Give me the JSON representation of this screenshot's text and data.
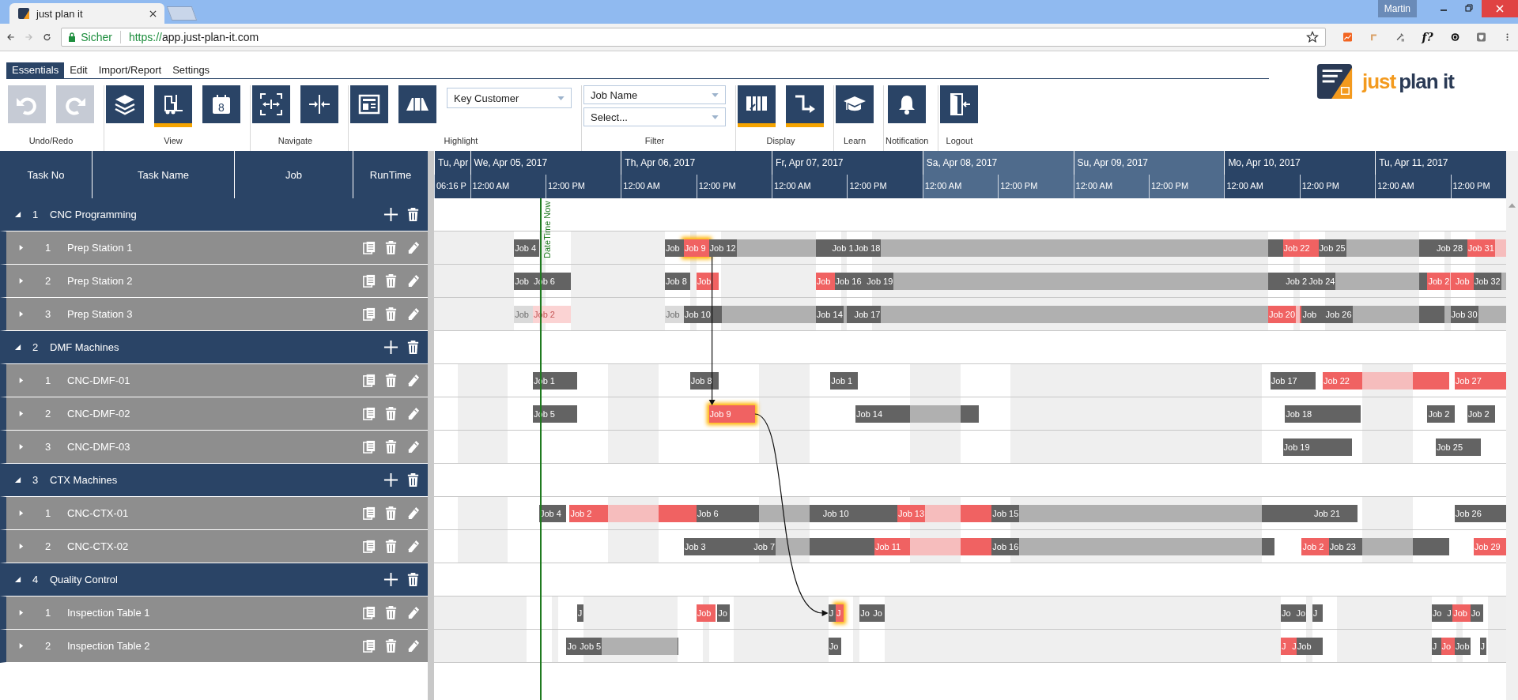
{
  "browser": {
    "tab_title": "just plan it",
    "user": "Martin",
    "security_label": "Sicher",
    "url_scheme": "https://",
    "url_host": "app.just-plan-it.com",
    "extension_text": "f?"
  },
  "ribbon": {
    "tabs": [
      {
        "label": "Essentials",
        "selected": true
      },
      {
        "label": "Edit",
        "selected": false
      },
      {
        "label": "Import/Report",
        "selected": false
      },
      {
        "label": "Settings",
        "selected": false
      }
    ],
    "groups": [
      {
        "label": "Undo/Redo",
        "items": [
          {
            "kind": "button",
            "active": false,
            "disabled": true
          },
          {
            "kind": "button",
            "active": false,
            "disabled": true
          }
        ]
      },
      {
        "label": "View",
        "items": [
          {
            "kind": "button",
            "active": false,
            "disabled": false
          },
          {
            "kind": "button",
            "active": true,
            "disabled": false
          },
          {
            "kind": "button",
            "icon_text": "8",
            "active": false,
            "disabled": false
          }
        ]
      },
      {
        "label": "Navigate",
        "items": [
          {
            "kind": "button",
            "active": false,
            "disabled": false
          },
          {
            "kind": "button",
            "active": false,
            "disabled": false
          }
        ]
      },
      {
        "label": "Highlight",
        "items": [
          {
            "kind": "button",
            "active": false,
            "disabled": false
          },
          {
            "kind": "button",
            "active": false,
            "disabled": false
          },
          {
            "kind": "dropdown",
            "value": "Key Customer"
          }
        ]
      },
      {
        "label": "Filter",
        "items": [
          {
            "kind": "dropdown_stack",
            "fields": [
              {
                "value": "Job Name"
              },
              {
                "value": "Select..."
              }
            ]
          }
        ]
      },
      {
        "label": "Display",
        "items": [
          {
            "kind": "button",
            "active": true,
            "disabled": false
          },
          {
            "kind": "button",
            "active": true,
            "disabled": false
          }
        ]
      },
      {
        "label": "Learn",
        "items": [
          {
            "kind": "button",
            "active": false,
            "disabled": false
          }
        ]
      },
      {
        "label": "Notification",
        "items": [
          {
            "kind": "button",
            "active": false,
            "disabled": false
          }
        ]
      },
      {
        "label": "Logout",
        "items": [
          {
            "kind": "button",
            "active": false,
            "disabled": false
          }
        ]
      }
    ]
  },
  "logo": {
    "word_1": "just",
    "word_2": "plan it"
  },
  "timeline": {
    "days": [
      {
        "label": "Tu, Apr",
        "weekend": false,
        "ticks": [
          "06:16 P"
        ]
      },
      {
        "label": "We, Apr 05, 2017",
        "weekend": false,
        "ticks": [
          "12:00 AM",
          "12:00 PM"
        ]
      },
      {
        "label": "Th, Apr 06, 2017",
        "weekend": false,
        "ticks": [
          "12:00 AM",
          "12:00 PM"
        ]
      },
      {
        "label": "Fr, Apr 07, 2017",
        "weekend": false,
        "ticks": [
          "12:00 AM",
          "12:00 PM"
        ]
      },
      {
        "label": "Sa, Apr 08, 2017",
        "weekend": true,
        "ticks": [
          "12:00 AM",
          "12:00 PM"
        ]
      },
      {
        "label": "Su, Apr 09, 2017",
        "weekend": true,
        "ticks": [
          "12:00 AM",
          "12:00 PM"
        ]
      },
      {
        "label": "Mo, Apr 10, 2017",
        "weekend": false,
        "ticks": [
          "12:00 AM",
          "12:00 PM"
        ]
      },
      {
        "label": "Tu, Apr 11, 2017",
        "weekend": false,
        "ticks": [
          "12:00 AM",
          "12:00 PM"
        ]
      }
    ],
    "now_line": {
      "label": "DateTime Now"
    }
  },
  "plan": {
    "columns": [
      "Task No",
      "Task Name",
      "Job",
      "RunTime"
    ],
    "groups": [
      {
        "number": "1",
        "name": "CNC Programming",
        "expanded": true,
        "resources": [
          {
            "number": "1",
            "name": "Prep Station 1",
            "expanded": false,
            "jobs": [
              {
                "label": "Job 4",
                "kind": "regular",
                "highlighted": false
              },
              {
                "label": "Job",
                "kind": "regular",
                "highlighted": false
              },
              {
                "label": "Job 9",
                "kind": "late",
                "highlighted": true
              },
              {
                "label": "Job 12",
                "kind": "regular",
                "highlighted": false
              },
              {
                "label": "Job 1",
                "kind": "regular",
                "highlighted": false
              },
              {
                "label": "Job 18",
                "kind": "regular",
                "highlighted": false
              },
              {
                "label": "Job 22",
                "kind": "late",
                "highlighted": false
              },
              {
                "label": "Job 25",
                "kind": "regular",
                "highlighted": false
              },
              {
                "label": "Job 28",
                "kind": "regular",
                "highlighted": false
              },
              {
                "label": "Job 31",
                "kind": "late",
                "highlighted": false
              }
            ]
          },
          {
            "number": "2",
            "name": "Prep Station 2",
            "expanded": false,
            "jobs": [
              {
                "label": "Job",
                "kind": "regular",
                "highlighted": false
              },
              {
                "label": "Job 6",
                "kind": "regular",
                "highlighted": false
              },
              {
                "label": "Job 8",
                "kind": "regular",
                "highlighted": false
              },
              {
                "label": "Job",
                "kind": "late",
                "highlighted": false
              },
              {
                "label": "Job",
                "kind": "late",
                "highlighted": false
              },
              {
                "label": "Job 16",
                "kind": "regular",
                "highlighted": false
              },
              {
                "label": "Job 19",
                "kind": "regular",
                "highlighted": false
              },
              {
                "label": "Job 2",
                "kind": "regular",
                "highlighted": false
              },
              {
                "label": "Job 24",
                "kind": "regular",
                "highlighted": false
              },
              {
                "label": "Job 2",
                "kind": "late",
                "highlighted": false
              },
              {
                "label": "Job",
                "kind": "late",
                "highlighted": false
              },
              {
                "label": "Job 32",
                "kind": "regular",
                "highlighted": false
              }
            ]
          },
          {
            "number": "3",
            "name": "Prep Station 3",
            "expanded": false,
            "jobs": [
              {
                "label": "Job",
                "kind": "done",
                "highlighted": false
              },
              {
                "label": "Job 2",
                "kind": "done-late",
                "highlighted": false
              },
              {
                "label": "Job",
                "kind": "done",
                "highlighted": false
              },
              {
                "label": "Job 10",
                "kind": "regular",
                "highlighted": false
              },
              {
                "label": "Job 14",
                "kind": "regular",
                "highlighted": false
              },
              {
                "label": "Job 17",
                "kind": "regular",
                "highlighted": false
              },
              {
                "label": "Job 20",
                "kind": "late",
                "highlighted": false
              },
              {
                "label": "Job",
                "kind": "regular",
                "highlighted": false
              },
              {
                "label": "Job 26",
                "kind": "regular",
                "highlighted": false
              },
              {
                "label": "Job 30",
                "kind": "regular",
                "highlighted": false
              }
            ]
          }
        ]
      },
      {
        "number": "2",
        "name": "DMF Machines",
        "expanded": true,
        "resources": [
          {
            "number": "1",
            "name": "CNC-DMF-01",
            "expanded": false,
            "jobs": [
              {
                "label": "Job 1",
                "kind": "regular",
                "highlighted": false
              },
              {
                "label": "Job 8",
                "kind": "regular",
                "highlighted": false
              },
              {
                "label": "Job 1",
                "kind": "regular",
                "highlighted": false
              },
              {
                "label": "Job 17",
                "kind": "regular",
                "highlighted": false
              },
              {
                "label": "Job 22",
                "kind": "late",
                "highlighted": false
              },
              {
                "label": "Job 27",
                "kind": "late",
                "highlighted": false
              }
            ]
          },
          {
            "number": "2",
            "name": "CNC-DMF-02",
            "expanded": false,
            "jobs": [
              {
                "label": "Job 5",
                "kind": "regular",
                "highlighted": false
              },
              {
                "label": "Job 9",
                "kind": "late",
                "highlighted": true
              },
              {
                "label": "Job 14",
                "kind": "regular",
                "highlighted": false
              },
              {
                "label": "Job 18",
                "kind": "regular",
                "highlighted": false
              },
              {
                "label": "Job 2",
                "kind": "regular",
                "highlighted": false
              },
              {
                "label": "Job 2",
                "kind": "regular",
                "highlighted": false
              }
            ]
          },
          {
            "number": "3",
            "name": "CNC-DMF-03",
            "expanded": false,
            "jobs": [
              {
                "label": "Job 19",
                "kind": "regular",
                "highlighted": false
              },
              {
                "label": "Job 25",
                "kind": "regular",
                "highlighted": false
              }
            ]
          }
        ]
      },
      {
        "number": "3",
        "name": "CTX Machines",
        "expanded": true,
        "resources": [
          {
            "number": "1",
            "name": "CNC-CTX-01",
            "expanded": false,
            "jobs": [
              {
                "label": "Job 4",
                "kind": "regular",
                "highlighted": false
              },
              {
                "label": "Job 2",
                "kind": "late",
                "highlighted": false
              },
              {
                "label": "Job 6",
                "kind": "regular",
                "highlighted": false
              },
              {
                "label": "Job 10",
                "kind": "regular",
                "highlighted": false
              },
              {
                "label": "Job 13",
                "kind": "late",
                "highlighted": false
              },
              {
                "label": "Job 15",
                "kind": "regular",
                "highlighted": false
              },
              {
                "label": "Job 21",
                "kind": "regular",
                "highlighted": false
              },
              {
                "label": "Job 26",
                "kind": "regular",
                "highlighted": false
              }
            ]
          },
          {
            "number": "2",
            "name": "CNC-CTX-02",
            "expanded": false,
            "jobs": [
              {
                "label": "Job 3",
                "kind": "regular",
                "highlighted": false
              },
              {
                "label": "Job 7",
                "kind": "regular",
                "highlighted": false
              },
              {
                "label": "Job 11",
                "kind": "late",
                "highlighted": false
              },
              {
                "label": "Job 16",
                "kind": "regular",
                "highlighted": false
              },
              {
                "label": "Job 2",
                "kind": "late",
                "highlighted": false
              },
              {
                "label": "Job 23",
                "kind": "regular",
                "highlighted": false
              },
              {
                "label": "Job 29",
                "kind": "late",
                "highlighted": false
              }
            ]
          }
        ]
      },
      {
        "number": "4",
        "name": "Quality Control",
        "expanded": true,
        "resources": [
          {
            "number": "1",
            "name": "Inspection Table 1",
            "expanded": false,
            "jobs": [
              {
                "label": "J",
                "kind": "regular",
                "highlighted": false
              },
              {
                "label": "Job",
                "kind": "late",
                "highlighted": false
              },
              {
                "label": "Jo",
                "kind": "regular",
                "highlighted": false
              },
              {
                "label": "J",
                "kind": "regular",
                "highlighted": false
              },
              {
                "label": "J",
                "kind": "late",
                "highlighted": true
              },
              {
                "label": "Jo",
                "kind": "regular",
                "highlighted": false
              },
              {
                "label": "Jo",
                "kind": "regular",
                "highlighted": false
              },
              {
                "label": "Jo",
                "kind": "regular",
                "highlighted": false
              },
              {
                "label": "Jo",
                "kind": "regular",
                "highlighted": false
              },
              {
                "label": "J",
                "kind": "regular",
                "highlighted": false
              },
              {
                "label": "Jo",
                "kind": "regular",
                "highlighted": false
              },
              {
                "label": "J",
                "kind": "regular",
                "highlighted": false
              },
              {
                "label": "Job",
                "kind": "late",
                "highlighted": false
              },
              {
                "label": "Jo",
                "kind": "regular",
                "highlighted": false
              }
            ]
          },
          {
            "number": "2",
            "name": "Inspection Table 2",
            "expanded": false,
            "jobs": [
              {
                "label": "Jo",
                "kind": "regular",
                "highlighted": false
              },
              {
                "label": "Job 5",
                "kind": "regular",
                "highlighted": false
              },
              {
                "label": "Jo",
                "kind": "regular",
                "highlighted": false
              },
              {
                "label": "J",
                "kind": "late",
                "highlighted": false
              },
              {
                "label": "J",
                "kind": "late",
                "highlighted": false
              },
              {
                "label": "Job",
                "kind": "regular",
                "highlighted": false
              },
              {
                "label": "J",
                "kind": "regular",
                "highlighted": false
              },
              {
                "label": "Jo",
                "kind": "late",
                "highlighted": false
              },
              {
                "label": "Job",
                "kind": "regular",
                "highlighted": false
              },
              {
                "label": "J",
                "kind": "regular",
                "highlighted": false
              }
            ]
          }
        ]
      }
    ]
  }
}
